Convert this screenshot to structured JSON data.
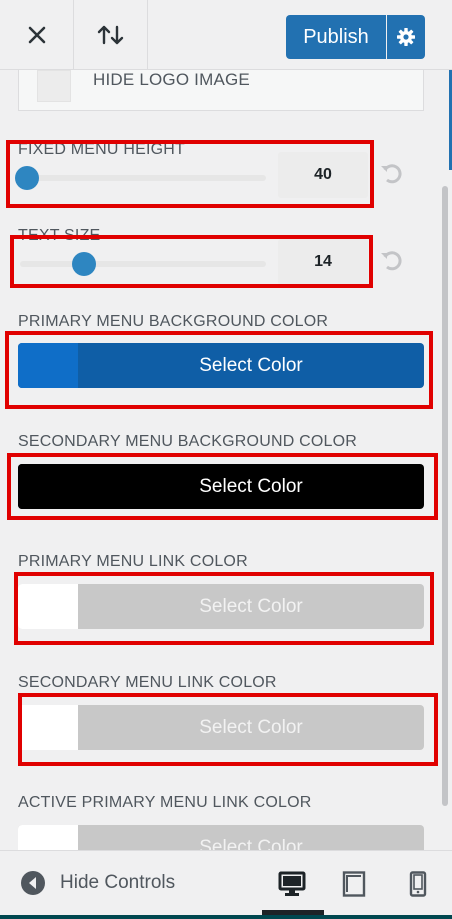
{
  "header": {
    "close_icon": "close-icon",
    "sort_icon": "sort-arrows-icon",
    "publish_label": "Publish",
    "settings_icon": "gear-icon",
    "accent_color": "#2271b1"
  },
  "panel": {
    "hide_logo_label": "HIDE LOGO IMAGE",
    "fixed_menu_height": {
      "label": "FIXED MENU HEIGHT",
      "value": "40",
      "slider_fraction": 0.03
    },
    "text_size": {
      "label": "TEXT SIZE",
      "value": "14",
      "slider_fraction": 0.26
    },
    "colors": [
      {
        "label": "PRIMARY MENU BACKGROUND COLOR",
        "button_label": "Select Color",
        "swatch": "#0f6ec8",
        "bg": "#0f5ea6",
        "text_color": "#ffffff"
      },
      {
        "label": "SECONDARY MENU BACKGROUND COLOR",
        "button_label": "Select Color",
        "swatch": "#000000",
        "bg": "#000000",
        "text_color": "#ffffff"
      },
      {
        "label": "PRIMARY MENU LINK COLOR",
        "button_label": "Select Color",
        "swatch": "#ffffff",
        "bg": "#c8c8c8",
        "text_color": "#f2f2f2"
      },
      {
        "label": "SECONDARY MENU LINK COLOR",
        "button_label": "Select Color",
        "swatch": "#ffffff",
        "bg": "#c8c8c8",
        "text_color": "#f2f2f2"
      },
      {
        "label": "ACTIVE PRIMARY MENU LINK COLOR",
        "button_label": "Select Color",
        "swatch": "#ffffff",
        "bg": "#c8c8c8",
        "text_color": "#f2f2f2"
      }
    ]
  },
  "footer": {
    "hide_controls_label": "Hide Controls",
    "devices": [
      "desktop-icon",
      "tablet-icon",
      "mobile-icon"
    ],
    "active_device": "desktop"
  },
  "highlight_color": "#e00000"
}
